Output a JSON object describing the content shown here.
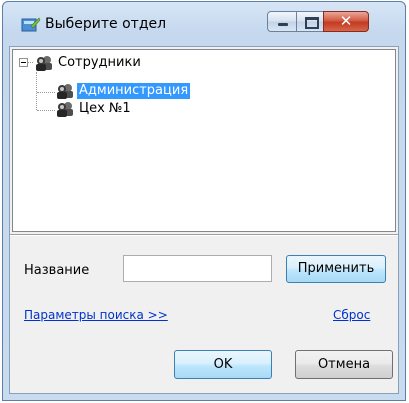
{
  "window": {
    "title": "Выберите отдел",
    "icon": "department-icon",
    "controls": {
      "minimize": "minimize-icon",
      "maximize": "maximize-icon",
      "close": "close-icon"
    }
  },
  "tree": {
    "root": {
      "label": "Сотрудники",
      "expanded": true,
      "icon": "employees-icon"
    },
    "children": [
      {
        "label": "Администрация",
        "selected": true,
        "icon": "employees-icon"
      },
      {
        "label": "Цех №1",
        "selected": false,
        "icon": "employees-icon"
      }
    ]
  },
  "filter": {
    "name_label": "Название",
    "name_value": "",
    "apply_label": "Применить",
    "search_params_link": "Параметры поиска >>",
    "reset_link": "Сброс"
  },
  "footer": {
    "ok_label": "OK",
    "cancel_label": "Отмена"
  },
  "colors": {
    "selection": "#3399ff",
    "link": "#0033cc",
    "close_button": "#c23a20"
  }
}
